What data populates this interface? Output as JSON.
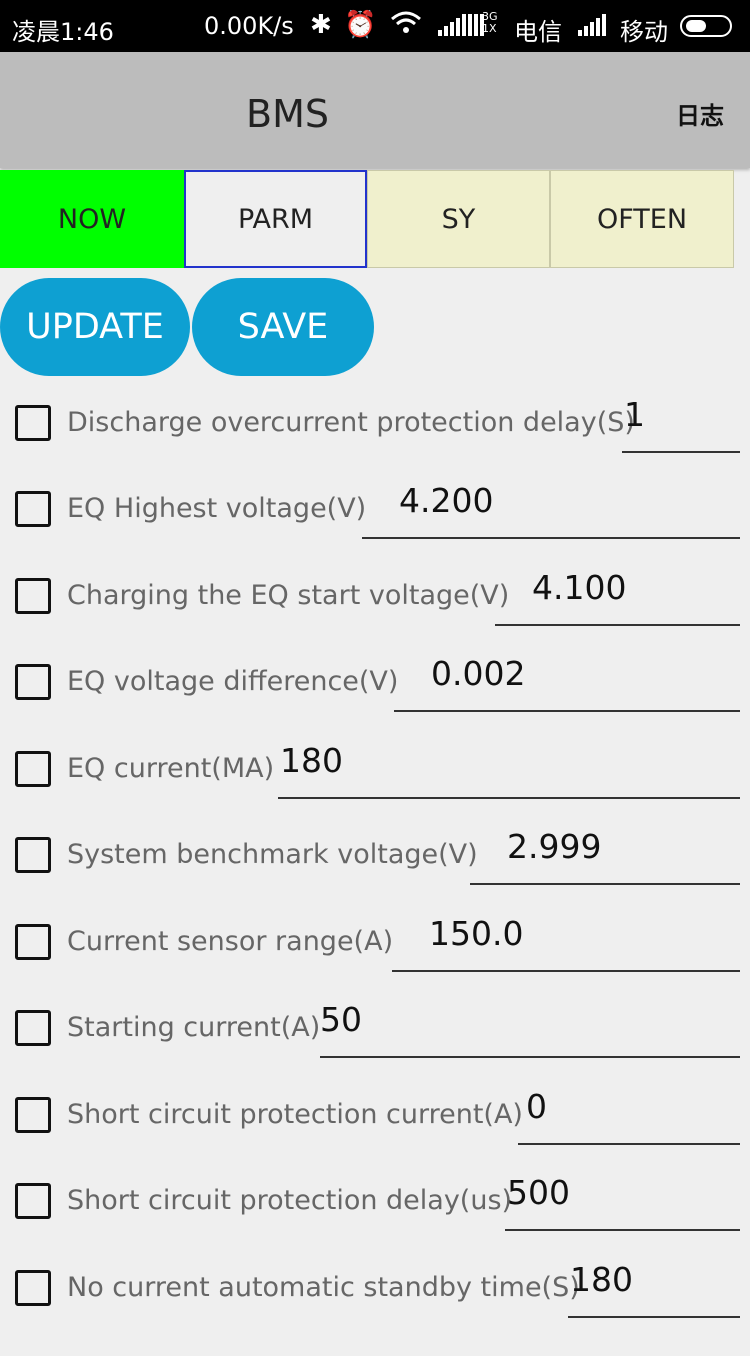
{
  "status_bar": {
    "time": "凌晨1:46",
    "speed": "0.00K/s",
    "net_type_top": "3G",
    "net_type_bottom": "1X",
    "carrier1": "电信",
    "carrier2": "移动",
    "icons": [
      "bluetooth-icon",
      "alarm-icon",
      "wifi-icon",
      "signal-icon",
      "battery-icon"
    ]
  },
  "app_bar": {
    "title": "BMS",
    "log_label": "日志"
  },
  "tabs": [
    {
      "label": "NOW",
      "color": "#00ff00"
    },
    {
      "label": "PARM",
      "selected": true
    },
    {
      "label": "SY"
    },
    {
      "label": "OFTEN"
    }
  ],
  "buttons": {
    "update": "UPDATE",
    "save": "SAVE",
    "accent": "#0ea0d2"
  },
  "params": [
    {
      "label": "Discharge overcurrent protection delay(S)",
      "value": "1"
    },
    {
      "label": "EQ Highest voltage(V)",
      "value": "4.200"
    },
    {
      "label": "Charging the EQ start voltage(V)",
      "value": "4.100"
    },
    {
      "label": "EQ voltage difference(V)",
      "value": "0.002"
    },
    {
      "label": "EQ current(MA)",
      "value": "180"
    },
    {
      "label": "System benchmark voltage(V)",
      "value": "2.999"
    },
    {
      "label": "Current sensor range(A)",
      "value": "150.0"
    },
    {
      "label": "Starting current(A)",
      "value": "50"
    },
    {
      "label": "Short circuit protection current(A)",
      "value": "0"
    },
    {
      "label": "Short circuit protection delay(us)",
      "value": "500"
    },
    {
      "label": "No current automatic standby time(S)",
      "value": "180"
    }
  ]
}
